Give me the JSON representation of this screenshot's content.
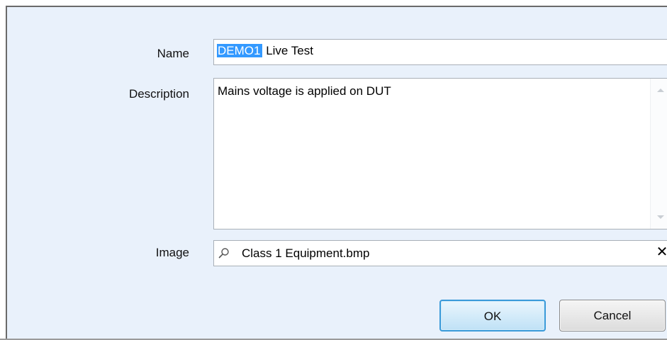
{
  "form": {
    "name_label": "Name",
    "name_selected": "DEMO1",
    "name_rest": " Live Test",
    "description_label": "Description",
    "description_value": "Mains voltage is applied on DUT",
    "image_label": "Image",
    "image_value": "Class 1 Equipment.bmp"
  },
  "buttons": {
    "ok_label": "OK",
    "cancel_label": "Cancel"
  },
  "icons": {
    "search": "search-icon",
    "clear": "close-icon",
    "scroll_up": "chevron-up-icon",
    "scroll_down": "chevron-down-icon"
  },
  "colors": {
    "dialog_background": "#e9f1fb",
    "selection": "#3399ff",
    "ok_border": "#3a9ad9"
  }
}
